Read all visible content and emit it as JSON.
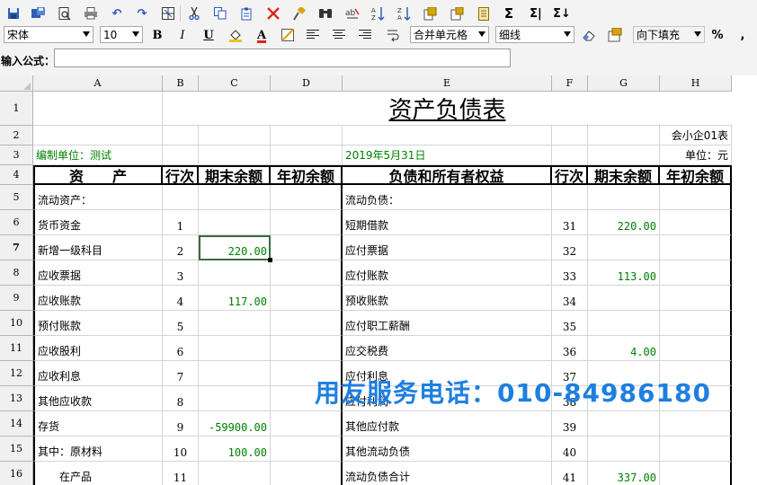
{
  "toolbar": {
    "icons": [
      "save-icon",
      "save-as-icon",
      "print-preview-icon",
      "print-icon",
      "undo-icon",
      "redo-icon",
      "grid-icon",
      "cut-icon",
      "copy-icon",
      "paste-icon",
      "delete-icon",
      "format-painter-icon",
      "find-icon",
      "replace-icon",
      "sort-ascending-icon",
      "sort-descending-icon",
      "insert-row-icon",
      "insert-column-icon",
      "page-icon",
      "sum-icon",
      "sum-row-icon",
      "sum-column-icon"
    ],
    "sum_glyph": "Σ",
    "sum_row_glyph": "Σ|",
    "sum_col_glyph": "Σ↓"
  },
  "format_bar": {
    "font_name": "宋体",
    "font_size": "10",
    "bold": "B",
    "italic": "I",
    "underline": "U",
    "font_color": "A",
    "merge_cells": "合并单元格",
    "border_style": "细线",
    "fill_direction": "向下填充",
    "percent": "%",
    "comma": ","
  },
  "formula_bar": {
    "label": "输入公式：",
    "value": ""
  },
  "sheet": {
    "columns": [
      "A",
      "B",
      "C",
      "D",
      "E",
      "F",
      "G",
      "H"
    ],
    "rows": [
      "1",
      "2",
      "3",
      "4",
      "5",
      "6",
      "7",
      "8",
      "9",
      "10",
      "11",
      "12",
      "13",
      "14",
      "15",
      "16"
    ],
    "active_row": "7",
    "title": "资产负债表",
    "template_code": "会小企01表",
    "unit": "单位：元",
    "company": "编制单位：测试",
    "date": "2019年5月31日",
    "headers": {
      "asset": "资　　产",
      "line_no": "行次",
      "ending_balance": "期末余额",
      "beginning_balance": "年初余额",
      "liability": "负债和所有者权益",
      "line_no_2": "行次",
      "ending_balance_2": "期末余额",
      "beginning_balance_2": "年初余额"
    },
    "data_rows": [
      {
        "asset": "流动资产：",
        "no": "",
        "end": "",
        "begin": "",
        "liab": "流动负债：",
        "no2": "",
        "end2": "",
        "begin2": ""
      },
      {
        "asset": "货币资金",
        "no": "1",
        "end": "",
        "begin": "",
        "liab": "短期借款",
        "no2": "31",
        "end2": "220.00",
        "begin2": ""
      },
      {
        "asset": "新增一级科目",
        "no": "2",
        "end": "220.00",
        "begin": "",
        "liab": "应付票据",
        "no2": "32",
        "end2": "",
        "begin2": ""
      },
      {
        "asset": "应收票据",
        "no": "3",
        "end": "",
        "begin": "",
        "liab": "应付账款",
        "no2": "33",
        "end2": "113.00",
        "begin2": ""
      },
      {
        "asset": "应收账款",
        "no": "4",
        "end": "117.00",
        "begin": "",
        "liab": "预收账款",
        "no2": "34",
        "end2": "",
        "begin2": ""
      },
      {
        "asset": "预付账款",
        "no": "5",
        "end": "",
        "begin": "",
        "liab": "应付职工薪酬",
        "no2": "35",
        "end2": "",
        "begin2": ""
      },
      {
        "asset": "应收股利",
        "no": "6",
        "end": "",
        "begin": "",
        "liab": "应交税费",
        "no2": "36",
        "end2": "4.00",
        "begin2": ""
      },
      {
        "asset": "应收利息",
        "no": "7",
        "end": "",
        "begin": "",
        "liab": "应付利息",
        "no2": "37",
        "end2": "",
        "begin2": ""
      },
      {
        "asset": "其他应收款",
        "no": "8",
        "end": "",
        "begin": "",
        "liab": "应付利润",
        "no2": "38",
        "end2": "",
        "begin2": ""
      },
      {
        "asset": "存货",
        "no": "9",
        "end": "-59900.00",
        "begin": "",
        "liab": "其他应付款",
        "no2": "39",
        "end2": "",
        "begin2": ""
      },
      {
        "asset": "其中：原材料",
        "no": "10",
        "end": "100.00",
        "begin": "",
        "liab": "其他流动负债",
        "no2": "40",
        "end2": "",
        "begin2": ""
      },
      {
        "asset": "　　在产品",
        "no": "11",
        "end": "",
        "begin": "",
        "liab": "流动负债合计",
        "no2": "41",
        "end2": "337.00",
        "begin2": ""
      }
    ]
  },
  "watermark": "用友服务电话：010-84986180"
}
